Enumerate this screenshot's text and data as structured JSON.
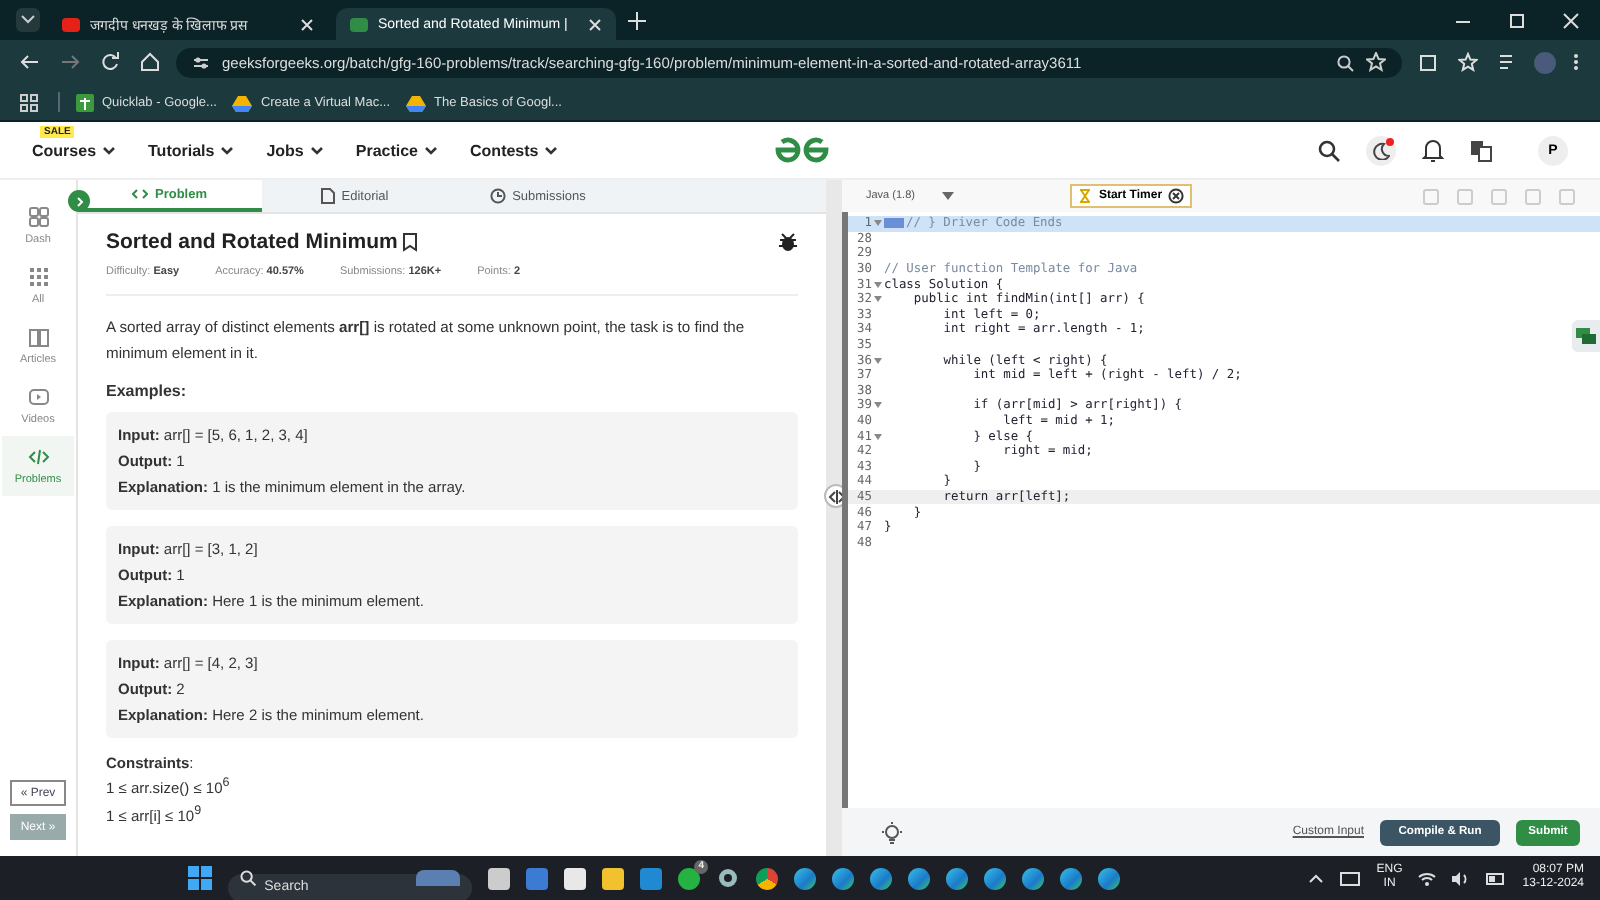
{
  "browser": {
    "tabs": [
      {
        "title": "जगदीप धनखड़ के खिलाफ प्रस",
        "selected": false
      },
      {
        "title": "Sorted and Rotated Minimum |",
        "selected": true
      }
    ],
    "url": "geeksforgeeks.org/batch/gfg-160-problems/track/searching-gfg-160/problem/minimum-element-in-a-sorted-and-rotated-array3611",
    "bookmarks": [
      "Quicklab - Google...",
      "Create a Virtual Mac...",
      "The Basics of Googl..."
    ]
  },
  "site_nav": {
    "sale_badge": "SALE",
    "menus": [
      "Courses",
      "Tutorials",
      "Jobs",
      "Practice",
      "Contests"
    ],
    "avatar": "P"
  },
  "sidebar": {
    "items": [
      {
        "label": "Dash",
        "selected": false
      },
      {
        "label": "All",
        "selected": false
      },
      {
        "label": "Articles",
        "selected": false
      },
      {
        "label": "Videos",
        "selected": false
      },
      {
        "label": "Problems",
        "selected": true
      }
    ],
    "prev": "« Prev",
    "next": "Next »"
  },
  "problem": {
    "tabs": [
      {
        "label": "Problem",
        "selected": true
      },
      {
        "label": "Editorial",
        "selected": false
      },
      {
        "label": "Submissions",
        "selected": false
      }
    ],
    "title": "Sorted and Rotated Minimum",
    "meta": [
      {
        "label": "Difficulty:",
        "value": "Easy"
      },
      {
        "label": "Accuracy:",
        "value": "40.57%"
      },
      {
        "label": "Submissions:",
        "value": "126K+"
      },
      {
        "label": "Points:",
        "value": "2"
      }
    ],
    "description": "A sorted array of distinct elements **arr[]** is rotated at some unknown point, the task is to find the minimum element in it.",
    "examples_heading": "Examples:",
    "examples": [
      {
        "input": "**Input:** arr[] = [5, 6, 1, 2, 3, 4]",
        "output": "**Output:** 1",
        "explanation": "**Explanation:** 1 is the minimum element in the array."
      },
      {
        "input": "**Input:** arr[] = [3, 1, 2]",
        "output": "**Output:** 1",
        "explanation": "**Explanation:** Here 1 is the minimum element."
      },
      {
        "input": "**Input:** arr[] = [4, 2, 3]",
        "output": "**Output:** 2",
        "explanation": "**Explanation:** Here 2 is the minimum element."
      }
    ],
    "constraints_heading": "**Constraints**:",
    "constraints": [
      "1 ≤ arr.size() ≤ 10$^{6}$",
      "1 ≤ arr[i] ≤ 10$^{9}$"
    ]
  },
  "editor": {
    "language": "Java (1.8)",
    "timer_button": "Start Timer",
    "lines": [
      {
        "number": "1",
        "text": "// } Driver Code Ends",
        "foldable": true,
        "kind": "folded",
        "current": false
      },
      {
        "number": "28",
        "foldable": false,
        "kind": "code",
        "current": false
      },
      {
        "number": "29",
        "foldable": false,
        "kind": "code",
        "current": false
      },
      {
        "number": "30",
        "text": "// User function Template for Java",
        "foldable": false,
        "kind": "comment",
        "current": false
      },
      {
        "number": "31",
        "text": "class Solution {",
        "foldable": true,
        "kind": "code",
        "current": false
      },
      {
        "number": "32",
        "text": "    public int findMin(int[] arr) {",
        "foldable": true,
        "kind": "code",
        "current": false
      },
      {
        "number": "33",
        "text": "        int left = 0;",
        "foldable": false,
        "kind": "code",
        "current": false
      },
      {
        "number": "34",
        "text": "        int right = arr.length - 1;",
        "foldable": false,
        "kind": "code",
        "current": false
      },
      {
        "number": "35",
        "foldable": false,
        "kind": "code",
        "current": false
      },
      {
        "number": "36",
        "text": "        while (left < right) {",
        "foldable": true,
        "kind": "code",
        "current": false
      },
      {
        "number": "37",
        "text": "            int mid = left + (right - left) / 2;",
        "foldable": false,
        "kind": "code",
        "current": false
      },
      {
        "number": "38",
        "foldable": false,
        "kind": "code",
        "current": false
      },
      {
        "number": "39",
        "text": "            if (arr[mid] > arr[right]) {",
        "foldable": true,
        "kind": "code",
        "current": false
      },
      {
        "number": "40",
        "text": "                left = mid + 1;",
        "foldable": false,
        "kind": "code",
        "current": false
      },
      {
        "number": "41",
        "text": "            } else {",
        "foldable": true,
        "kind": "code",
        "current": false
      },
      {
        "number": "42",
        "text": "                right = mid;",
        "foldable": false,
        "kind": "code",
        "current": false
      },
      {
        "number": "43",
        "text": "            }",
        "foldable": false,
        "kind": "code",
        "current": false
      },
      {
        "number": "44",
        "text": "        }",
        "foldable": false,
        "kind": "code",
        "current": false
      },
      {
        "number": "45",
        "text": "        return arr[left];",
        "foldable": false,
        "kind": "code",
        "current": true
      },
      {
        "number": "46",
        "text": "    }",
        "foldable": false,
        "kind": "code",
        "current": false
      },
      {
        "number": "47",
        "text": "}",
        "foldable": false,
        "kind": "code",
        "current": false
      },
      {
        "number": "48",
        "foldable": false,
        "kind": "code",
        "current": false
      }
    ],
    "custom_input": "Custom Input",
    "compile_button": "Compile & Run",
    "submit_button": "Submit"
  },
  "taskbar": {
    "search_placeholder": "Search",
    "whatsapp_badge": "4",
    "language": "ENG",
    "region": "IN",
    "time": "08:07 PM",
    "date": "13-12-2024"
  }
}
